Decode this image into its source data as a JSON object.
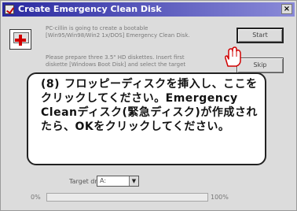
{
  "window": {
    "title": "Create Emergency Clean Disk",
    "close_glyph": "×",
    "icon": "emergency-clean-app-icon"
  },
  "messages": {
    "line1": "PC-cillin is going to create a bootable",
    "line2": "[Win95/Win98/Win2 1x/DOS] Emergency Clean Disk.",
    "line3": "Please prepare three 3.5\" HD diskettes. Insert first",
    "line4": "diskette [Windows Boot Disk] and select the target"
  },
  "buttons": {
    "start": "Start",
    "skip": "Skip"
  },
  "callout": {
    "step": "(8)",
    "text": "フロッピーディスクを挿入し、ここをクリックしてください。Emergency Cleanディスク(緊急ディスク)が作成されたら、OKをクリックしてください。"
  },
  "target_drive": {
    "label": "Target drive:",
    "value": "A:"
  },
  "progress": {
    "left_label": "0%",
    "right_label": "100%",
    "value": 0
  },
  "colors": {
    "title_bar": "#2a2aa0",
    "accent": "#d00000"
  }
}
